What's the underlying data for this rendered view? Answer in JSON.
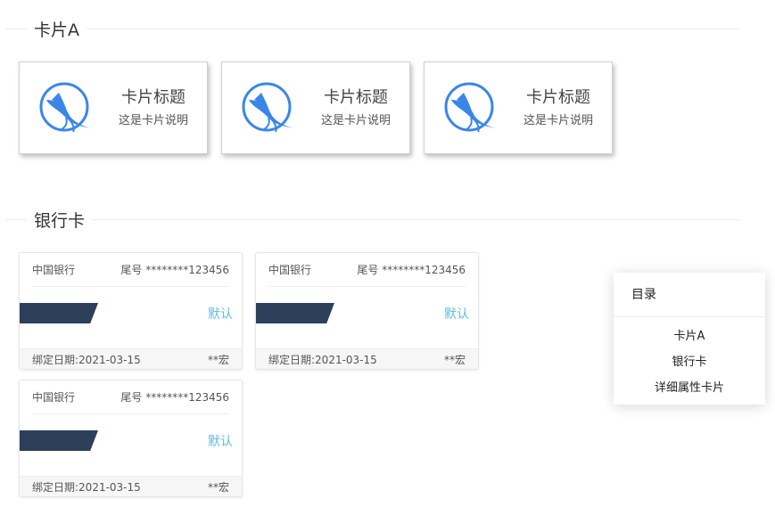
{
  "sections": {
    "card_a_title": "卡片A",
    "bank_title": "银行卡"
  },
  "cards_a": [
    {
      "title": "卡片标题",
      "desc": "这是卡片说明",
      "icon": "bird-logo-icon"
    },
    {
      "title": "卡片标题",
      "desc": "这是卡片说明",
      "icon": "bird-logo-icon"
    },
    {
      "title": "卡片标题",
      "desc": "这是卡片说明",
      "icon": "bird-logo-icon"
    }
  ],
  "bank_cards": [
    {
      "bank": "中国银行",
      "tail": "尾号 ********123456",
      "default": "默认",
      "bind_date": "绑定日期:2021-03-15",
      "owner": "**宏"
    },
    {
      "bank": "中国银行",
      "tail": "尾号 ********123456",
      "default": "默认",
      "bind_date": "绑定日期:2021-03-15",
      "owner": "**宏"
    },
    {
      "bank": "中国银行",
      "tail": "尾号 ********123456",
      "default": "默认",
      "bind_date": "绑定日期:2021-03-15",
      "owner": "**宏"
    }
  ],
  "toc": {
    "title": "目录",
    "items": [
      "卡片A",
      "银行卡",
      "详细属性卡片"
    ]
  },
  "colors": {
    "accent": "#3a86e8",
    "band": "#2e3f5a",
    "default_text": "#5bbde8"
  }
}
